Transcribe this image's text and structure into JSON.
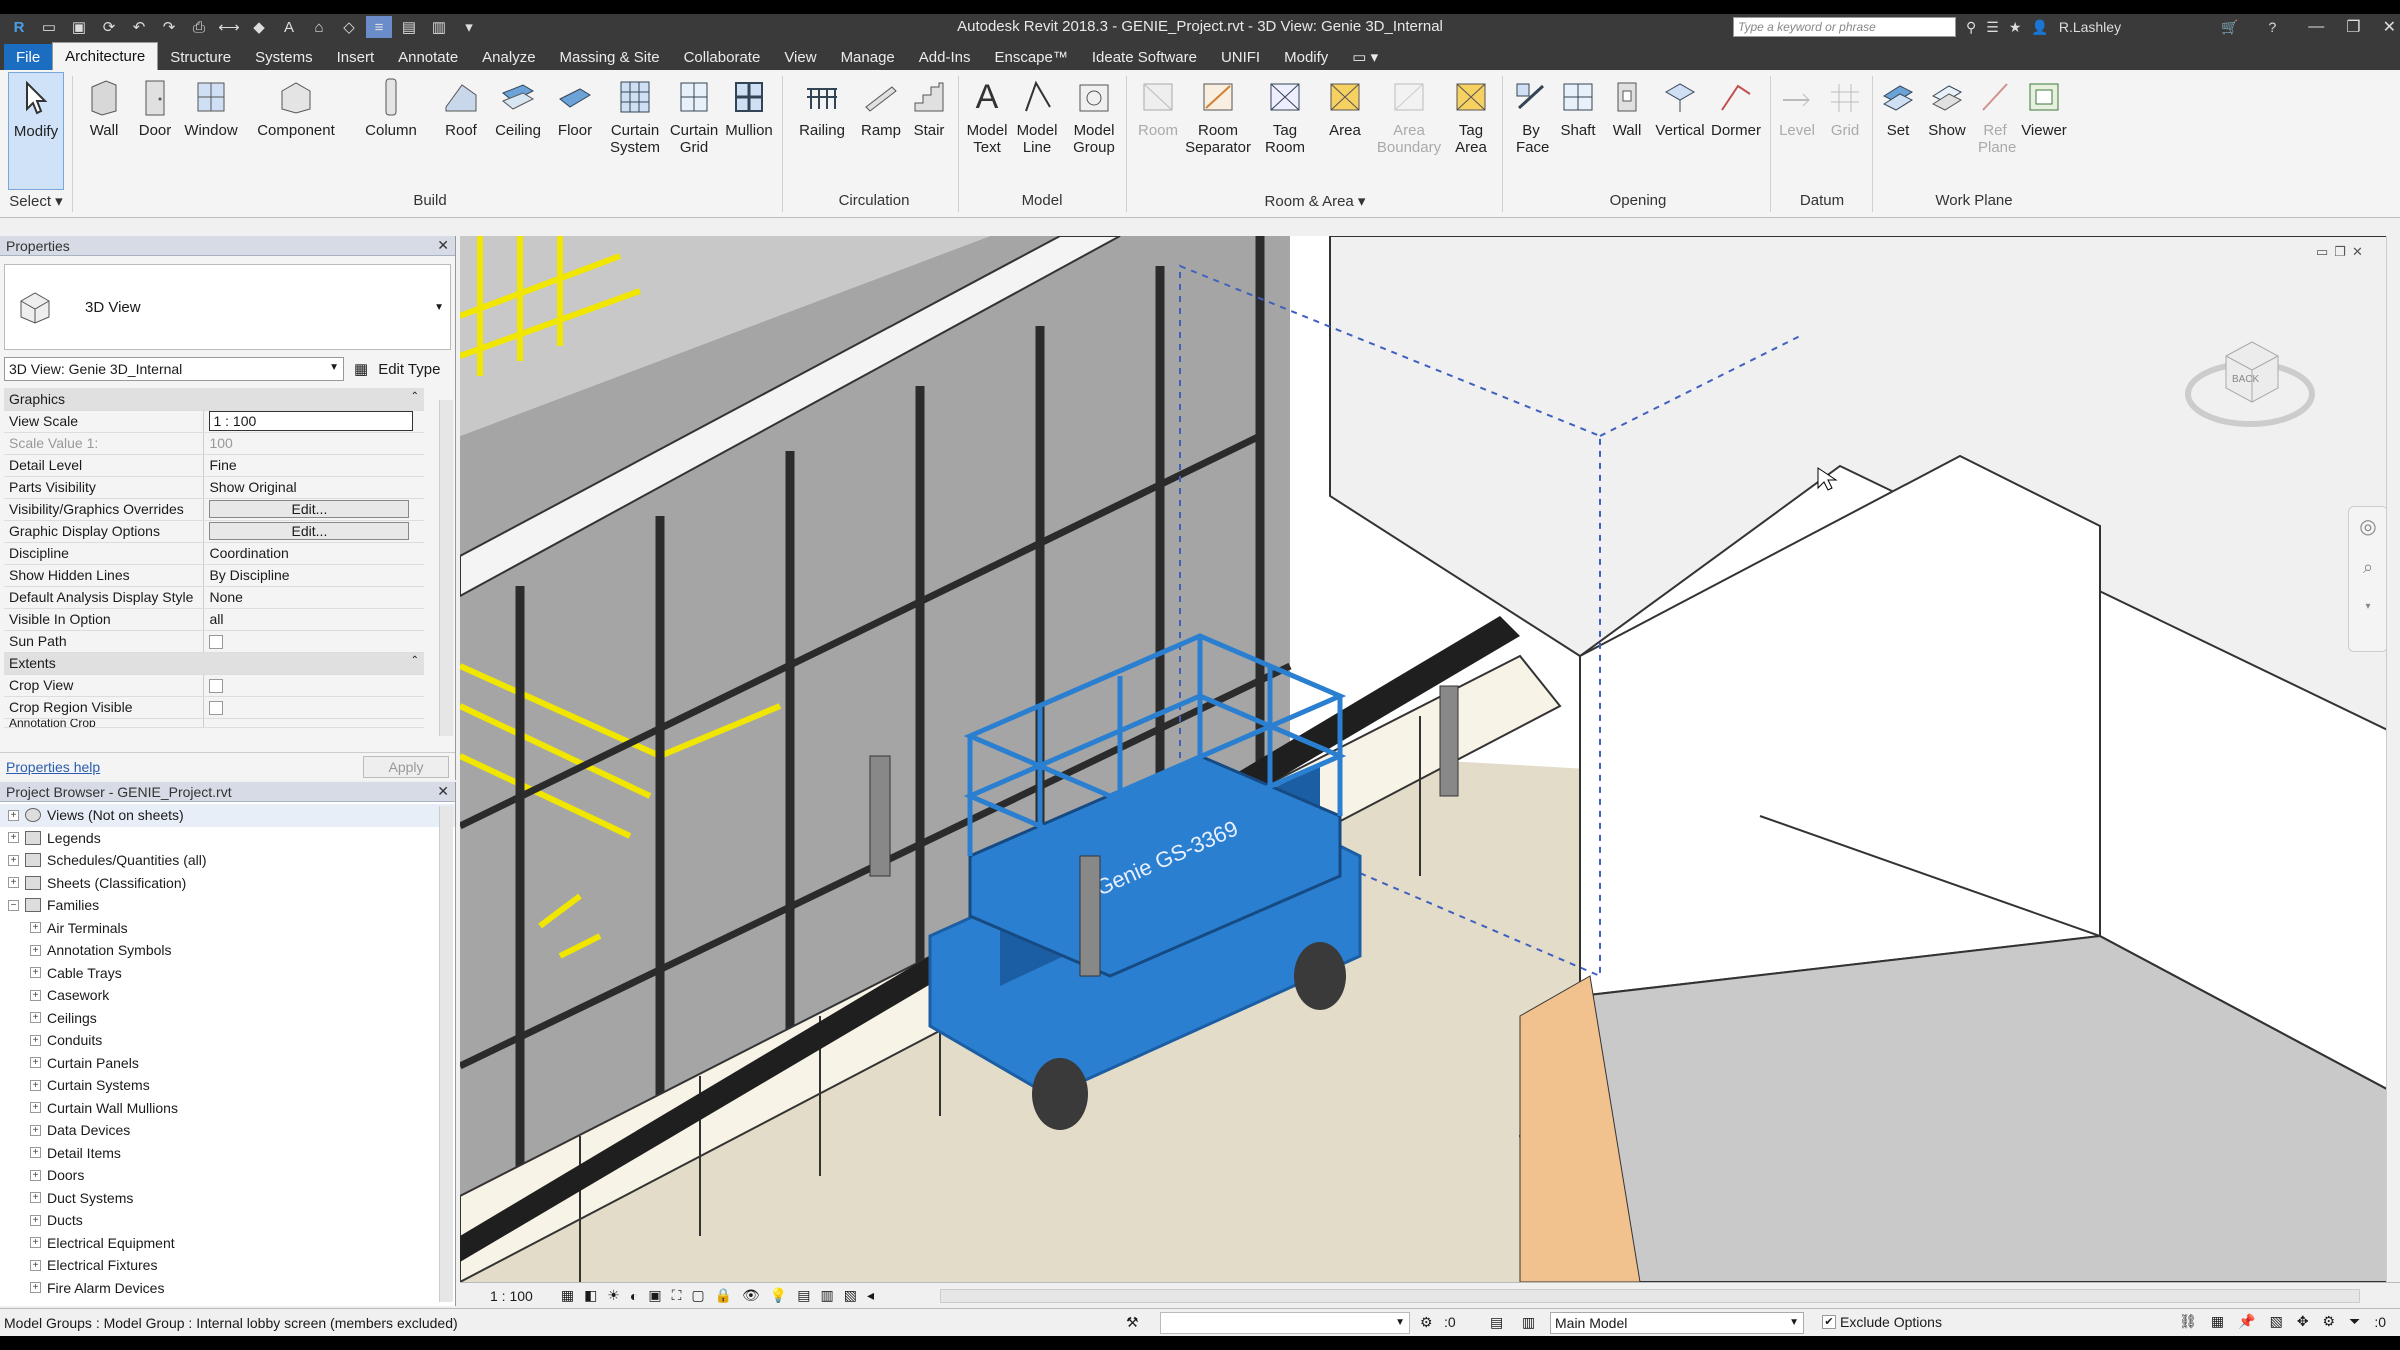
{
  "window": {
    "title": "Autodesk Revit 2018.3 -    GENIE_Project.rvt - 3D View: Genie 3D_Internal",
    "search_placeholder": "Type a keyword or phrase",
    "user": "R.Lashley"
  },
  "menu_tabs": [
    "File",
    "Architecture",
    "Structure",
    "Systems",
    "Insert",
    "Annotate",
    "Analyze",
    "Massing & Site",
    "Collaborate",
    "View",
    "Manage",
    "Add-Ins",
    "Enscape™",
    "Ideate Software",
    "UNIFI",
    "Modify"
  ],
  "ribbon": {
    "tools": {
      "modify": "Modify",
      "wall": "Wall",
      "door": "Door",
      "window": "Window",
      "component": "Component",
      "column": "Column",
      "roof": "Roof",
      "ceiling": "Ceiling",
      "floor": "Floor",
      "curtain_system": "Curtain System",
      "curtain_grid": "Curtain Grid",
      "mullion": "Mullion",
      "railing": "Railing",
      "ramp": "Ramp",
      "stair": "Stair",
      "model_text": "Model Text",
      "model_line": "Model Line",
      "model_group": "Model Group",
      "room": "Room",
      "room_separator": "Room Separator",
      "tag_room": "Tag Room",
      "area": "Area",
      "area_boundary": "Area Boundary",
      "tag_area": "Tag Area",
      "by_face": "By Face",
      "shaft": "Shaft",
      "op_wall": "Wall",
      "vertical": "Vertical",
      "dormer": "Dormer",
      "level": "Level",
      "grid": "Grid",
      "set": "Set",
      "show": "Show",
      "ref_plane": "Ref Plane",
      "viewer": "Viewer"
    },
    "groups": {
      "select": "Select ▾",
      "build": "Build",
      "circulation": "Circulation",
      "model": "Model",
      "room_area": "Room & Area ▾",
      "opening": "Opening",
      "datum": "Datum",
      "work_plane": "Work Plane"
    }
  },
  "properties": {
    "header": "Properties",
    "type_name": "3D View",
    "instance_selector": "3D View: Genie 3D_Internal",
    "edit_type": "Edit Type",
    "sections": {
      "graphics": "Graphics",
      "extents": "Extents"
    },
    "rows": [
      {
        "name": "View Scale",
        "value": "1 : 100"
      },
      {
        "name": "Scale Value    1:",
        "value": "100"
      },
      {
        "name": "Detail Level",
        "value": "Fine"
      },
      {
        "name": "Parts Visibility",
        "value": "Show Original"
      },
      {
        "name": "Visibility/Graphics Overrides",
        "value": "Edit..."
      },
      {
        "name": "Graphic Display Options",
        "value": "Edit..."
      },
      {
        "name": "Discipline",
        "value": "Coordination"
      },
      {
        "name": "Show Hidden Lines",
        "value": "By Discipline"
      },
      {
        "name": "Default Analysis Display Style",
        "value": "None"
      },
      {
        "name": "Visible In Option",
        "value": "all"
      },
      {
        "name": "Sun Path",
        "value": ""
      }
    ],
    "extents_rows": [
      {
        "name": "Crop View"
      },
      {
        "name": "Crop Region Visible"
      },
      {
        "name": "Annotation Crop"
      }
    ],
    "help_link": "Properties help",
    "apply": "Apply"
  },
  "browser": {
    "header": "Project Browser - GENIE_Project.rvt",
    "top": [
      "Views (Not on sheets)",
      "Legends",
      "Schedules/Quantities (all)",
      "Sheets (Classification)",
      "Families"
    ],
    "families": [
      "Air Terminals",
      "Annotation Symbols",
      "Cable Trays",
      "Casework",
      "Ceilings",
      "Conduits",
      "Curtain Panels",
      "Curtain Systems",
      "Curtain Wall Mullions",
      "Data Devices",
      "Detail Items",
      "Doors",
      "Duct Systems",
      "Ducts",
      "Electrical Equipment",
      "Electrical Fixtures",
      "Fire Alarm Devices"
    ]
  },
  "viewport": {
    "scale": "1 : 100",
    "lift_label": "Genie GS-3369",
    "viewcube_face": "BACK",
    "colors": {
      "lift": "#2a7fd1",
      "lift_dark": "#1b5ea3",
      "frame": "#2b2b2b",
      "glass": "#c6c6c6",
      "floor": "#e3dcc8",
      "wood": "#f2c28e",
      "wall": "#ffffff",
      "rail": "#f0e600"
    }
  },
  "status": {
    "message": "Model Groups : Model Group : Internal lobby screen (members excluded)",
    "worksets_count": ":0",
    "design_option": "Main Model",
    "exclude_options": "Exclude Options",
    "filter_count": ":0"
  }
}
